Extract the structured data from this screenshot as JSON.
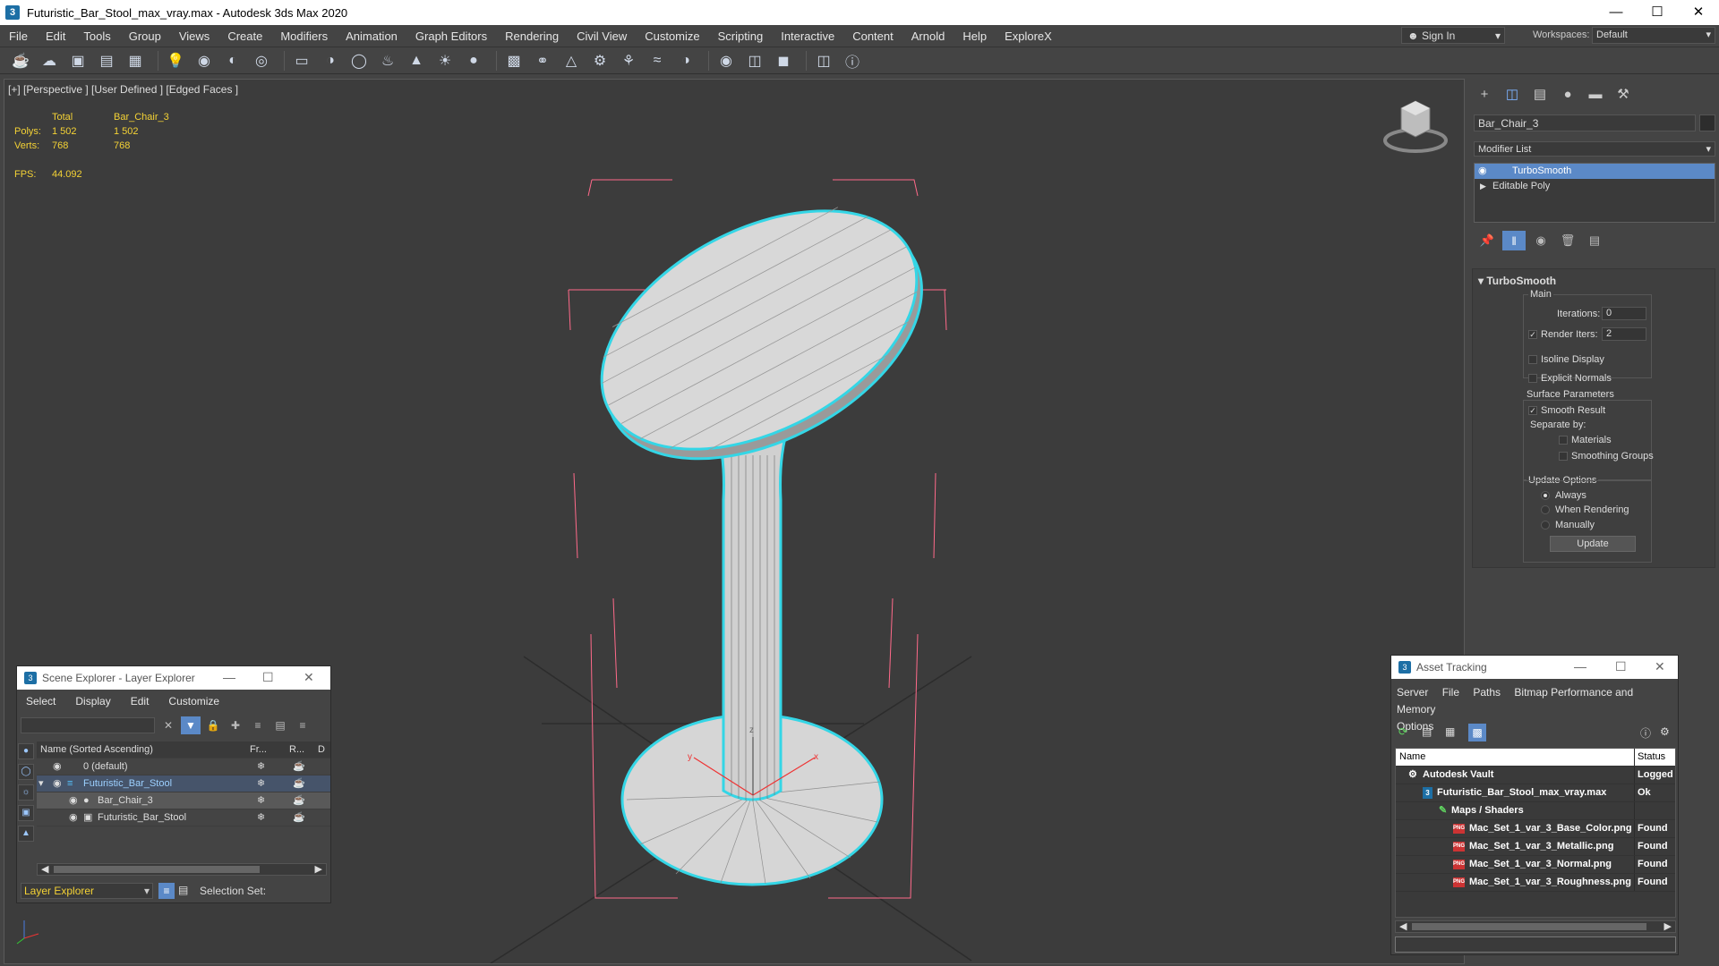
{
  "window": {
    "title": "Futuristic_Bar_Stool_max_vray.max - Autodesk 3ds Max 2020",
    "app_icon": "3"
  },
  "menu": [
    "File",
    "Edit",
    "Tools",
    "Group",
    "Views",
    "Create",
    "Modifiers",
    "Animation",
    "Graph Editors",
    "Rendering",
    "Civil View",
    "Customize",
    "Scripting",
    "Interactive",
    "Content",
    "Arnold",
    "Help",
    "ExploreX"
  ],
  "signin": "Sign In",
  "workspaces": {
    "label": "Workspaces:",
    "value": "Default"
  },
  "viewport": {
    "label": "[+] [Perspective ] [User Defined ] [Edged Faces ]",
    "stats": {
      "total_label": "Total",
      "object_label": "Bar_Chair_3",
      "polys_label": "Polys:",
      "polys_total": "1 502",
      "polys_obj": "1 502",
      "verts_label": "Verts:",
      "verts_total": "768",
      "verts_obj": "768",
      "fps_label": "FPS:",
      "fps_value": "44.092"
    },
    "gizmo_labels": {
      "x": "x",
      "y": "y",
      "z": "z"
    }
  },
  "command_panel": {
    "object_name": "Bar_Chair_3",
    "modifier_list": "Modifier List",
    "stack": [
      "TurboSmooth",
      "Editable Poly"
    ],
    "turbosmooth": {
      "title": "TurboSmooth",
      "main": "Main",
      "iterations_label": "Iterations:",
      "iterations": "0",
      "render_iters_label": "Render Iters:",
      "render_iters": "2",
      "isoline": "Isoline Display",
      "explicit": "Explicit Normals",
      "surface_params": "Surface Parameters",
      "smooth_result": "Smooth Result",
      "separate_by": "Separate by:",
      "materials": "Materials",
      "smoothing_groups": "Smoothing Groups",
      "update_options": "Update Options",
      "always": "Always",
      "when_rendering": "When Rendering",
      "manually": "Manually",
      "update": "Update"
    }
  },
  "scene_explorer": {
    "title": "Scene Explorer - Layer Explorer",
    "menu": [
      "Select",
      "Display",
      "Edit",
      "Customize"
    ],
    "columns": {
      "name": "Name (Sorted Ascending)",
      "fr": "Fr...",
      "r": "R...",
      "d": "D"
    },
    "rows": [
      "0 (default)",
      "Futuristic_Bar_Stool",
      "Bar_Chair_3",
      "Futuristic_Bar_Stool"
    ],
    "footer_mode": "Layer Explorer",
    "selection_set": "Selection Set:"
  },
  "asset_tracking": {
    "title": "Asset Tracking",
    "menu": [
      "Server",
      "File",
      "Paths",
      "Bitmap Performance and Memory",
      "Options"
    ],
    "columns": {
      "name": "Name",
      "status": "Status"
    },
    "rows": [
      {
        "name": "Autodesk Vault",
        "status": "Logged"
      },
      {
        "name": "Futuristic_Bar_Stool_max_vray.max",
        "status": "Ok"
      },
      {
        "name": "Maps / Shaders",
        "status": ""
      },
      {
        "name": "Mac_Set_1_var_3_Base_Color.png",
        "status": "Found"
      },
      {
        "name": "Mac_Set_1_var_3_Metallic.png",
        "status": "Found"
      },
      {
        "name": "Mac_Set_1_var_3_Normal.png",
        "status": "Found"
      },
      {
        "name": "Mac_Set_1_var_3_Roughness.png",
        "status": "Found"
      }
    ],
    "png_badge": "PNG"
  },
  "colors": {
    "accent": "#5b89c7",
    "stats": "#f4d235",
    "selection_outline": "#34d6e6",
    "bbox": "#ff6a8a"
  }
}
